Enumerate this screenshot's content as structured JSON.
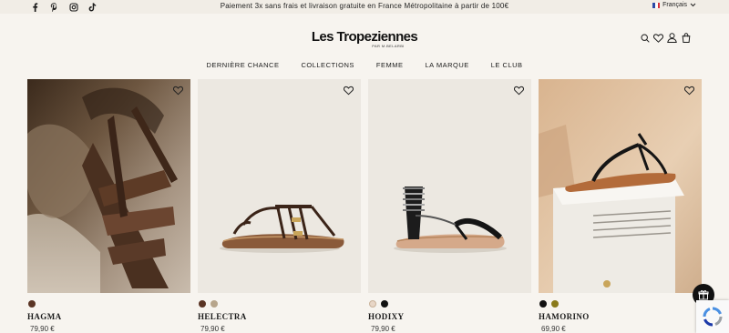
{
  "topbar": {
    "social_icons": [
      "facebook-icon",
      "pinterest-icon",
      "instagram-icon",
      "tiktok-icon"
    ],
    "promo_text": "Paiement 3x sans frais et livraison gratuite en France Métropolitaine à partir de 100€",
    "language": "Français"
  },
  "header": {
    "logo_main": "Les Tropeziennes",
    "logo_sub": "PAR M.BELARBI",
    "icons": [
      "search-icon",
      "heart-icon",
      "user-icon",
      "bag-icon"
    ]
  },
  "nav": {
    "items": [
      "DERNIÈRE CHANCE",
      "COLLECTIONS",
      "FEMME",
      "LA MARQUE",
      "LE CLUB"
    ]
  },
  "products": [
    {
      "name": "HAGMA",
      "price": "79,90 €",
      "swatches": [
        "#5a3424"
      ]
    },
    {
      "name": "HELECTRA",
      "price": "79,90 €",
      "swatches": [
        "#5a3424",
        "#b7a58b"
      ]
    },
    {
      "name": "HODIXY",
      "price": "79,90 €",
      "swatches": [
        "#e8d6c6",
        "#111111"
      ]
    },
    {
      "name": "HAMORINO",
      "price": "69,90 €",
      "swatches": [
        "#111111",
        "#8a7a1a"
      ]
    }
  ],
  "colors": {
    "background": "#f7f4ef",
    "topbar": "#f1ede6",
    "text": "#1b1b1b"
  }
}
